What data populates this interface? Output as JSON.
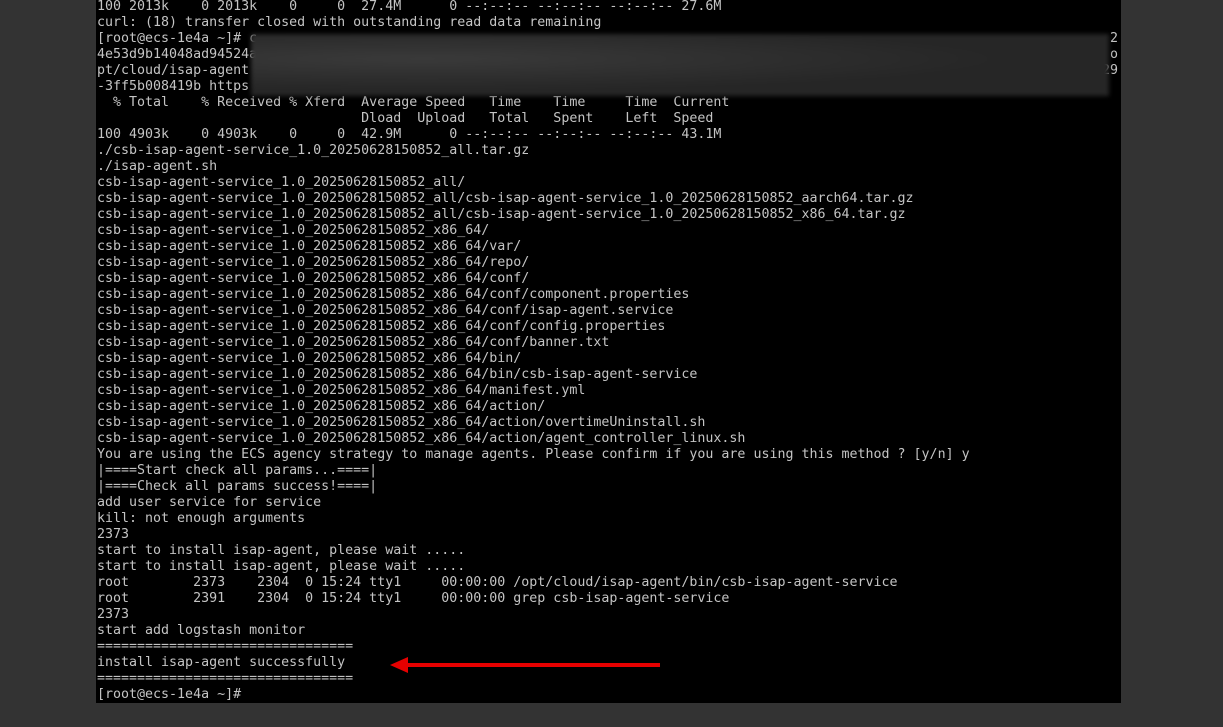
{
  "terminal": {
    "lines": [
      "100 2013k    0 2013k    0     0  27.4M      0 --:--:-- --:--:-- --:--:-- 27.6M",
      "curl: (18) transfer closed with outstanding read data remaining",
      "[root@ecs-1e4a ~]# c",
      "4e53d9b14048ad94524a",
      "pt/cloud/isap-agent",
      "-3ff5b008419b https",
      "  % Total    % Received % Xferd  Average Speed   Time    Time     Time  Current",
      "                                 Dload  Upload   Total   Spent    Left  Speed",
      "100 4903k    0 4903k    0     0  42.9M      0 --:--:-- --:--:-- --:--:-- 43.1M",
      "./csb-isap-agent-service_1.0_20250628150852_all.tar.gz",
      "./isap-agent.sh",
      "csb-isap-agent-service_1.0_20250628150852_all/",
      "csb-isap-agent-service_1.0_20250628150852_all/csb-isap-agent-service_1.0_20250628150852_aarch64.tar.gz",
      "csb-isap-agent-service_1.0_20250628150852_all/csb-isap-agent-service_1.0_20250628150852_x86_64.tar.gz",
      "csb-isap-agent-service_1.0_20250628150852_x86_64/",
      "csb-isap-agent-service_1.0_20250628150852_x86_64/var/",
      "csb-isap-agent-service_1.0_20250628150852_x86_64/repo/",
      "csb-isap-agent-service_1.0_20250628150852_x86_64/conf/",
      "csb-isap-agent-service_1.0_20250628150852_x86_64/conf/component.properties",
      "csb-isap-agent-service_1.0_20250628150852_x86_64/conf/isap-agent.service",
      "csb-isap-agent-service_1.0_20250628150852_x86_64/conf/config.properties",
      "csb-isap-agent-service_1.0_20250628150852_x86_64/conf/banner.txt",
      "csb-isap-agent-service_1.0_20250628150852_x86_64/bin/",
      "csb-isap-agent-service_1.0_20250628150852_x86_64/bin/csb-isap-agent-service",
      "csb-isap-agent-service_1.0_20250628150852_x86_64/manifest.yml",
      "csb-isap-agent-service_1.0_20250628150852_x86_64/action/",
      "csb-isap-agent-service_1.0_20250628150852_x86_64/action/overtimeUninstall.sh",
      "csb-isap-agent-service_1.0_20250628150852_x86_64/action/agent_controller_linux.sh",
      "You are using the ECS agency strategy to manage agents. Please confirm if you are using this method ? [y/n] y",
      "|====Start check all params...====|",
      "|====Check all params success!====|",
      "add user service for service",
      "kill: not enough arguments",
      "2373",
      "start to install isap-agent, please wait .....",
      "start to install isap-agent, please wait .....",
      "root        2373    2304  0 15:24 tty1     00:00:00 /opt/cloud/isap-agent/bin/csb-isap-agent-service",
      "root        2391    2304  0 15:24 tty1     00:00:00 grep csb-isap-agent-service",
      "2373",
      "start add logstash monitor",
      "================================",
      "install isap-agent successfully",
      "================================",
      "[root@ecs-1e4a ~]#"
    ],
    "tails": [
      {
        "line": 2,
        "text": "2"
      },
      {
        "line": 3,
        "text": "o"
      },
      {
        "line": 4,
        "text": "29"
      }
    ]
  },
  "annotation": {
    "arrow_color": "#e60000",
    "points_to_line": 41
  }
}
